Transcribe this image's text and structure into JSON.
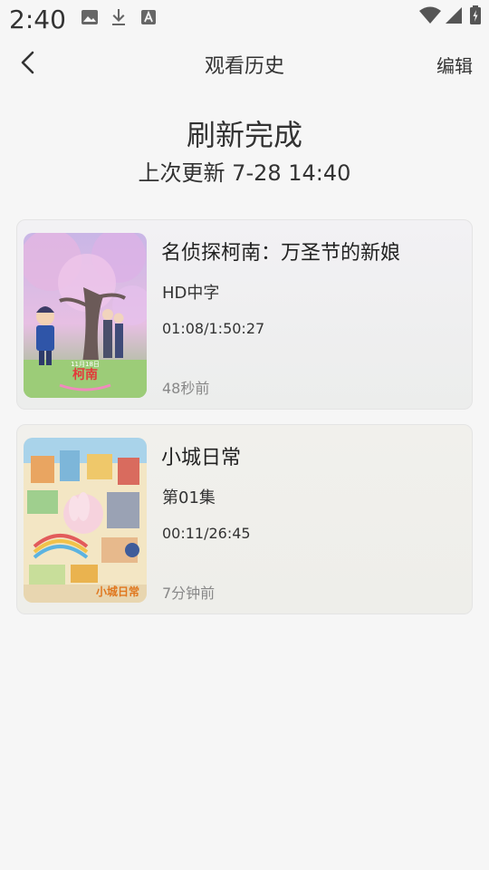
{
  "status_bar": {
    "time": "2:40",
    "icons": [
      "gallery-icon",
      "download-icon",
      "text-icon",
      "wifi-icon",
      "signal-icon",
      "battery-icon"
    ]
  },
  "header": {
    "back_icon": "chevron-left-icon",
    "title": "观看历史",
    "edit_label": "编辑"
  },
  "refresh": {
    "title": "刷新完成",
    "last_update": "上次更新 7-28 14:40"
  },
  "history": [
    {
      "title": "名侦探柯南：万圣节的新娘",
      "subtitle": "HD中字",
      "progress": "01:08/1:50:27",
      "watched_ago": "48秒前",
      "poster_text": "柯南"
    },
    {
      "title": "小城日常",
      "subtitle": "第01集",
      "progress": "00:11/26:45",
      "watched_ago": "7分钟前",
      "poster_text": "小城日常"
    }
  ],
  "colors": {
    "background": "#f6f6f6",
    "card_background": "#eeeeee",
    "secondary_text": "#888888"
  }
}
